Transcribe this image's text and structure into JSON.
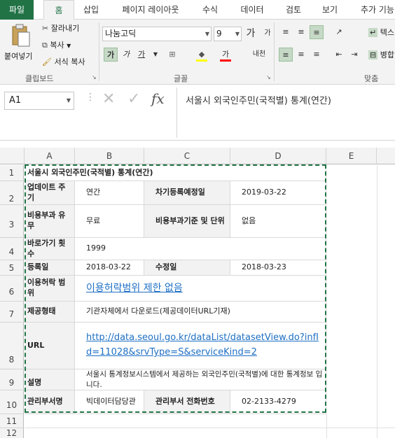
{
  "tabs": [
    "파일",
    "홈",
    "삽입",
    "페이지 레이아웃",
    "수식",
    "데이터",
    "검토",
    "보기",
    "추가 기능"
  ],
  "clipboard": {
    "paste": "붙여넣기",
    "cut": "잘라내기",
    "copy": "복사",
    "format_painter": "서식 복사",
    "group": "클립보드"
  },
  "font": {
    "name": "나눔고딕",
    "size": "9",
    "bold": "가",
    "italic": "가",
    "underline": "가",
    "group": "글꼴",
    "grow": "가",
    "shrink": "가",
    "color": "가",
    "phonetic": "내천"
  },
  "align": {
    "wrap": "텍스",
    "merge": "병합",
    "group": "맞춤"
  },
  "formula": {
    "namebox": "A1",
    "fx": "fx",
    "content": "서울시 외국인주민(국적별) 통계(연간)"
  },
  "columns": [
    "A",
    "B",
    "C",
    "D",
    "E"
  ],
  "rows": [
    "1",
    "2",
    "3",
    "4",
    "5",
    "6",
    "7",
    "8",
    "9",
    "10",
    "11",
    "12"
  ],
  "cells": {
    "title": "서울시 외국인주민(국적별) 통계(연간)",
    "r2a": "업데이트 주기",
    "r2b": "연간",
    "r2c": "차기등록예정일",
    "r2d": "2019-03-22",
    "r3a": "비용부과 유무",
    "r3b": "무료",
    "r3c": "비용부과기준 및 단위",
    "r3d": "없음",
    "r4a": "바로가기 횟수",
    "r4b": "1999",
    "r5a": "등록일",
    "r5b": "2018-03-22",
    "r5c": "수정일",
    "r5d": "2018-03-23",
    "r6a": "이용허락 범위",
    "r6b": "이용허락범위 제한 없음",
    "r7a": "제공형태",
    "r7b": "기관자체에서 다운로드(제공데이터URL기재)",
    "r8a": "URL",
    "r8b": "http://data.seoul.go.kr/dataList/datasetView.do?infId=11028&srvType=S&serviceKind=2",
    "r9a": "설명",
    "r9b": "서울시 통계정보시스템에서 제공하는 외국인주민(국적별)에 대한 통계정보 입니다.",
    "r10a": "관리부서명",
    "r10b": "빅데이터담당관",
    "r10c": "관리부서 전화번호",
    "r10d": "02-2133-4279"
  }
}
